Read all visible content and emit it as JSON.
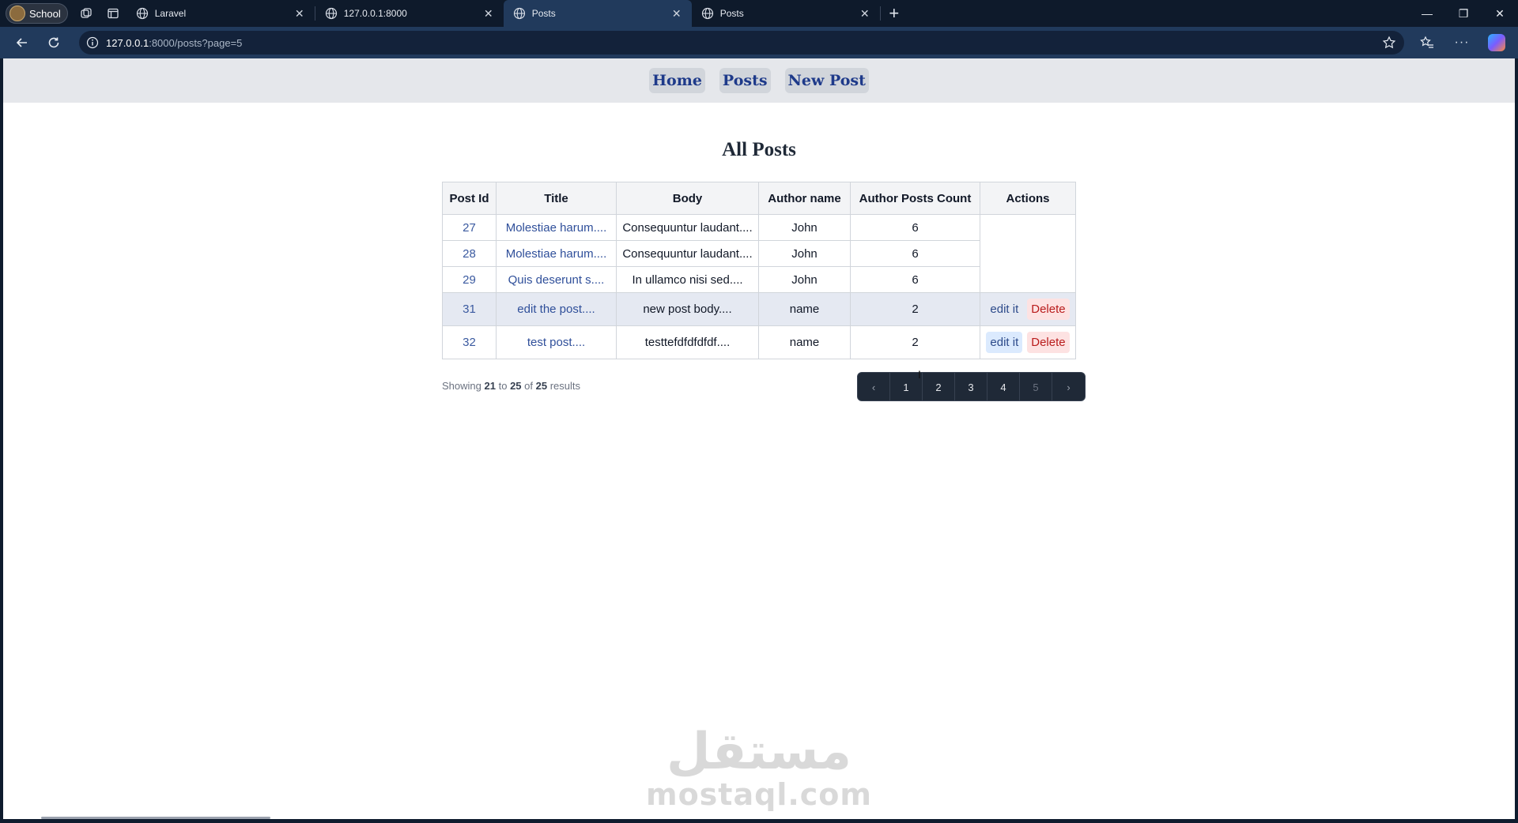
{
  "browser": {
    "profile_label": "School",
    "tabs": [
      {
        "title": "Laravel",
        "active": false
      },
      {
        "title": "127.0.0.1:8000",
        "active": false
      },
      {
        "title": "Posts",
        "active": true
      },
      {
        "title": "Posts",
        "active": false
      }
    ],
    "url_host": "127.0.0.1",
    "url_rest": ":8000/posts?page=5"
  },
  "site_nav": {
    "home": "Home",
    "posts": "Posts",
    "new_post": "New Post"
  },
  "page_title": "All Posts",
  "table": {
    "headers": [
      "Post Id",
      "Title",
      "Body",
      "Author name",
      "Author Posts Count",
      "Actions"
    ],
    "rows": [
      {
        "id": "27",
        "title": "Molestiae harum....",
        "body": "Consequuntur laudant....",
        "author": "John",
        "count": "6"
      },
      {
        "id": "28",
        "title": "Molestiae harum....",
        "body": "Consequuntur laudant....",
        "author": "John",
        "count": "6"
      },
      {
        "id": "29",
        "title": "Quis deserunt s....",
        "body": "In ullamco nisi sed....",
        "author": "John",
        "count": "6"
      },
      {
        "id": "31",
        "title": "edit the post....",
        "body": "new post body....",
        "author": "name",
        "count": "2",
        "edit": "edit it",
        "delete": "Delete"
      },
      {
        "id": "32",
        "title": "test post....",
        "body": "testtefdfdfdfdf....",
        "author": "name",
        "count": "2",
        "edit": "edit it",
        "delete": "Delete"
      }
    ]
  },
  "pagination": {
    "showing_prefix": "Showing",
    "from": "21",
    "to_word": "to",
    "to": "25",
    "of_word": "of",
    "total": "25",
    "results_word": "results",
    "pages": [
      "1",
      "2",
      "3",
      "4",
      "5"
    ],
    "prev_icon": "‹",
    "next_icon": "›"
  },
  "watermark": {
    "arabic": "مستقل",
    "latin": "mostaql.com"
  }
}
